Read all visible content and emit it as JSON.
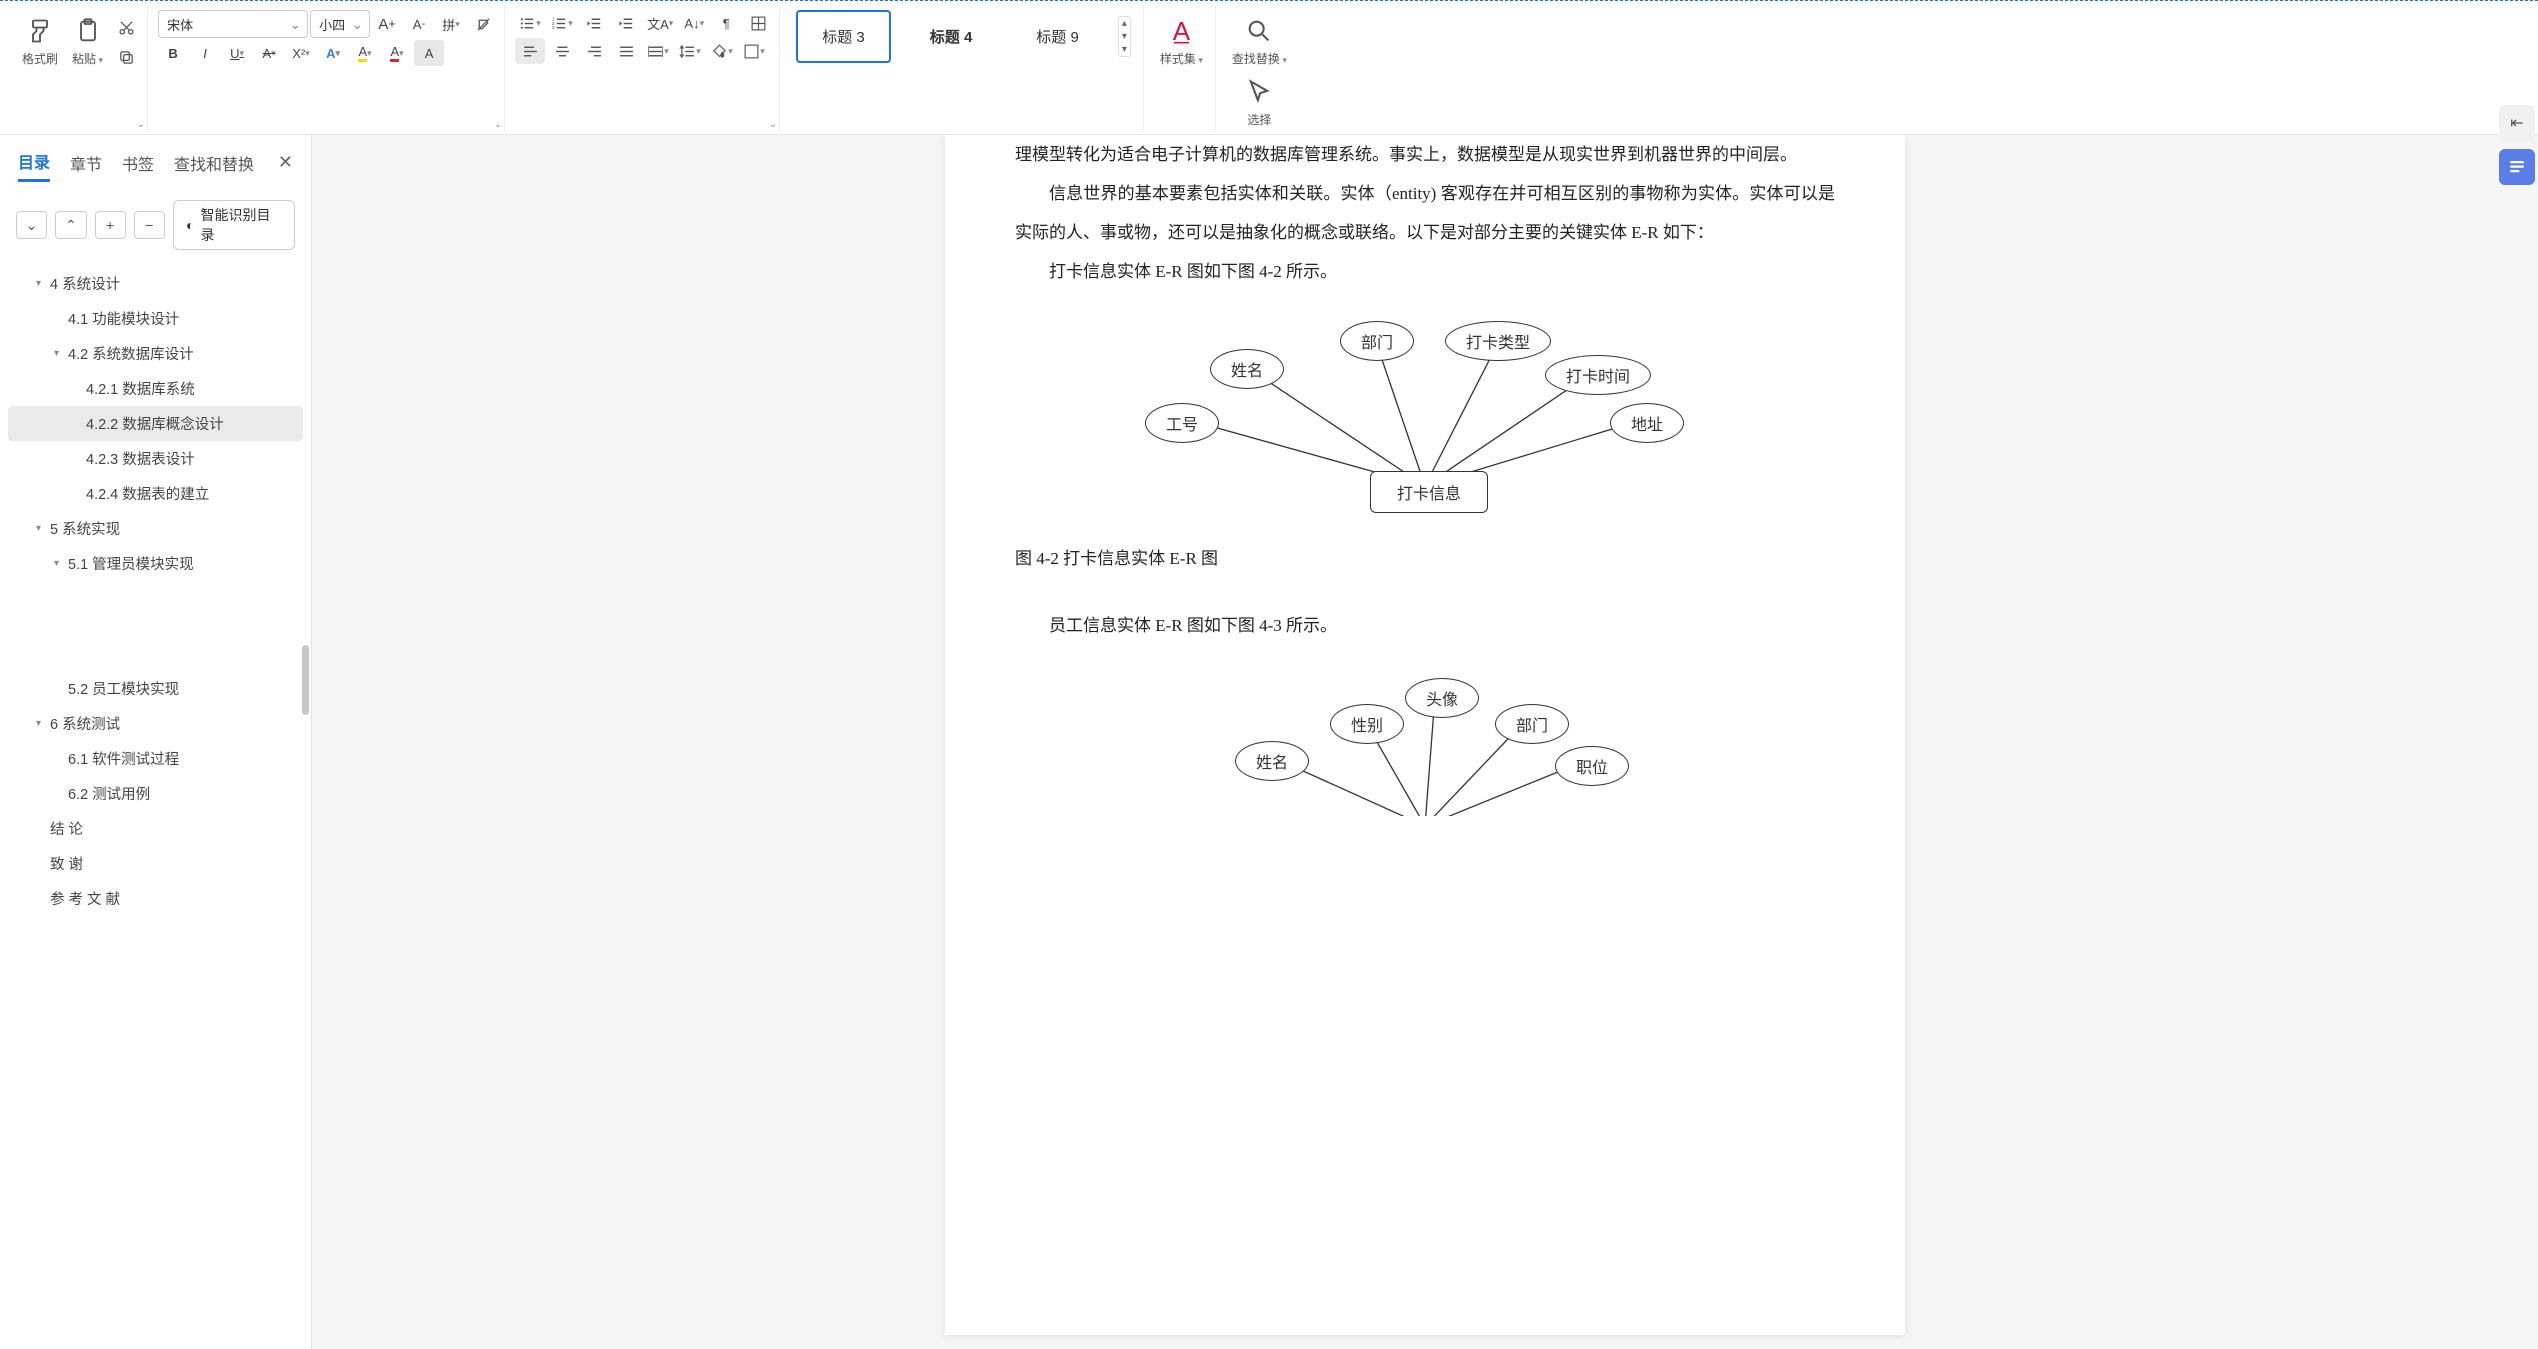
{
  "toolbar": {
    "format_painter": "格式刷",
    "paste": "粘贴",
    "font_name": "宋体",
    "font_size": "小四",
    "styles": {
      "s1": "标题 3",
      "s2": "标题 4",
      "s3": "标题 9"
    },
    "style_set": "样式集",
    "find_replace": "查找替换",
    "select": "选择"
  },
  "sidebar": {
    "tabs": {
      "toc": "目录",
      "chapter": "章节",
      "bookmark": "书签",
      "find": "查找和替换"
    },
    "smart_toc": "智能识别目录",
    "items": [
      {
        "lvl": 1,
        "caret": true,
        "text": "4   系统设计"
      },
      {
        "lvl": 2,
        "caret": false,
        "text": "4.1  功能模块设计"
      },
      {
        "lvl": 2,
        "caret": true,
        "text": "4.2  系统数据库设计"
      },
      {
        "lvl": 3,
        "caret": false,
        "text": "4.2.1  数据库系统"
      },
      {
        "lvl": 3,
        "caret": false,
        "text": "4.2.2  数据库概念设计",
        "active": true
      },
      {
        "lvl": 3,
        "caret": false,
        "text": "4.2.3  数据表设计"
      },
      {
        "lvl": 3,
        "caret": false,
        "text": "4.2.4  数据表的建立"
      },
      {
        "lvl": 1,
        "caret": true,
        "text": "5   系统实现"
      },
      {
        "lvl": 2,
        "caret": true,
        "text": "5.1  管理员模块实现"
      },
      {
        "lvl": 2,
        "caret": false,
        "text": "5.2  员工模块实现",
        "spacer": true
      },
      {
        "lvl": 1,
        "caret": true,
        "text": "6    系统测试"
      },
      {
        "lvl": 2,
        "caret": false,
        "text": "6.1  软件测试过程"
      },
      {
        "lvl": 2,
        "caret": false,
        "text": "6.2  测试用例"
      },
      {
        "lvl": 1,
        "caret": false,
        "text": "结      论"
      },
      {
        "lvl": 1,
        "caret": false,
        "text": "致      谢"
      },
      {
        "lvl": 1,
        "caret": false,
        "text": "参 考 文 献"
      }
    ]
  },
  "doc": {
    "p1": "理模型转化为适合电子计算机的数据库管理系统。事实上，数据模型是从现实世界到机器世界的中间层。",
    "p2": "信息世界的基本要素包括实体和关联。实体（entity) 客观存在并可相互区别的事物称为实体。实体可以是实际的人、事或物，还可以是抽象化的概念或联络。以下是对部分主要的关键实体 E-R 如下：",
    "p3": "打卡信息实体 E-R 图如下图 4-2 所示。",
    "caption1": "图 4-2 打卡信息实体 E-R 图",
    "p4": "员工信息实体 E-R 图如下图 4-3 所示。",
    "er1": {
      "center": "打卡信息",
      "attrs": {
        "a1": "工号",
        "a2": "姓名",
        "a3": "部门",
        "a4": "打卡类型",
        "a5": "打卡时间",
        "a6": "地址"
      }
    },
    "er2": {
      "attrs": {
        "b1": "姓名",
        "b2": "性别",
        "b3": "头像",
        "b4": "部门",
        "b5": "职位"
      }
    }
  }
}
